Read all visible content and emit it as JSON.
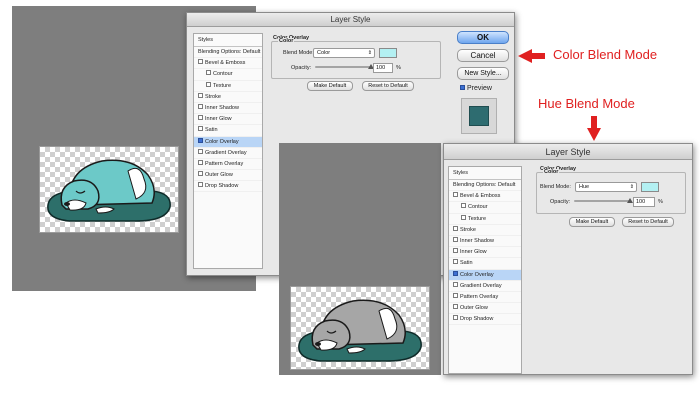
{
  "annotations": {
    "color_blend": "Color Blend Mode",
    "hue_blend": "Hue Blend Mode"
  },
  "colors": {
    "annotation": "#e02020",
    "overlay_swatch": "#b3f0f2",
    "dog_color": "#6cc9c8",
    "dog_grey": "#a6a6a6",
    "cushion": "#2d6f6a",
    "selected_row": "#b9d5f6"
  },
  "dialog_top": {
    "title": "Layer Style",
    "styles_header": "Styles",
    "blending_options": "Blending Options: Default",
    "items": [
      {
        "label": "Bevel & Emboss",
        "checked": false
      },
      {
        "label": "Contour",
        "checked": false
      },
      {
        "label": "Texture",
        "checked": false
      },
      {
        "label": "Stroke",
        "checked": false
      },
      {
        "label": "Inner Shadow",
        "checked": false
      },
      {
        "label": "Inner Glow",
        "checked": false
      },
      {
        "label": "Satin",
        "checked": false
      },
      {
        "label": "Color Overlay",
        "checked": true
      },
      {
        "label": "Gradient Overlay",
        "checked": false
      },
      {
        "label": "Pattern Overlay",
        "checked": false
      },
      {
        "label": "Outer Glow",
        "checked": false
      },
      {
        "label": "Drop Shadow",
        "checked": false
      }
    ],
    "panel_title": "Color Overlay",
    "group_title": "Color",
    "blend_mode_label": "Blend Mode:",
    "blend_mode_value": "Color",
    "opacity_label": "Opacity:",
    "opacity_value": "100",
    "opacity_unit": "%",
    "opacity_fraction": 1.0,
    "make_default": "Make Default",
    "reset_default": "Reset to Default",
    "ok": "OK",
    "cancel": "Cancel",
    "new_style": "New Style...",
    "preview_label": "Preview",
    "preview_checked": true
  },
  "dialog_bottom": {
    "title": "Layer Style",
    "styles_header": "Styles",
    "blending_options": "Blending Options: Default",
    "items": [
      {
        "label": "Bevel & Emboss",
        "checked": false
      },
      {
        "label": "Contour",
        "checked": false
      },
      {
        "label": "Texture",
        "checked": false
      },
      {
        "label": "Stroke",
        "checked": false
      },
      {
        "label": "Inner Shadow",
        "checked": false
      },
      {
        "label": "Inner Glow",
        "checked": false
      },
      {
        "label": "Satin",
        "checked": false
      },
      {
        "label": "Color Overlay",
        "checked": true
      },
      {
        "label": "Gradient Overlay",
        "checked": false
      },
      {
        "label": "Pattern Overlay",
        "checked": false
      },
      {
        "label": "Outer Glow",
        "checked": false
      },
      {
        "label": "Drop Shadow",
        "checked": false
      }
    ],
    "panel_title": "Color Overlay",
    "group_title": "Color",
    "blend_mode_label": "Blend Mode:",
    "blend_mode_value": "Hue",
    "opacity_label": "Opacity:",
    "opacity_value": "100",
    "opacity_unit": "%",
    "opacity_fraction": 1.0,
    "make_default": "Make Default",
    "reset_default": "Reset to Default"
  }
}
